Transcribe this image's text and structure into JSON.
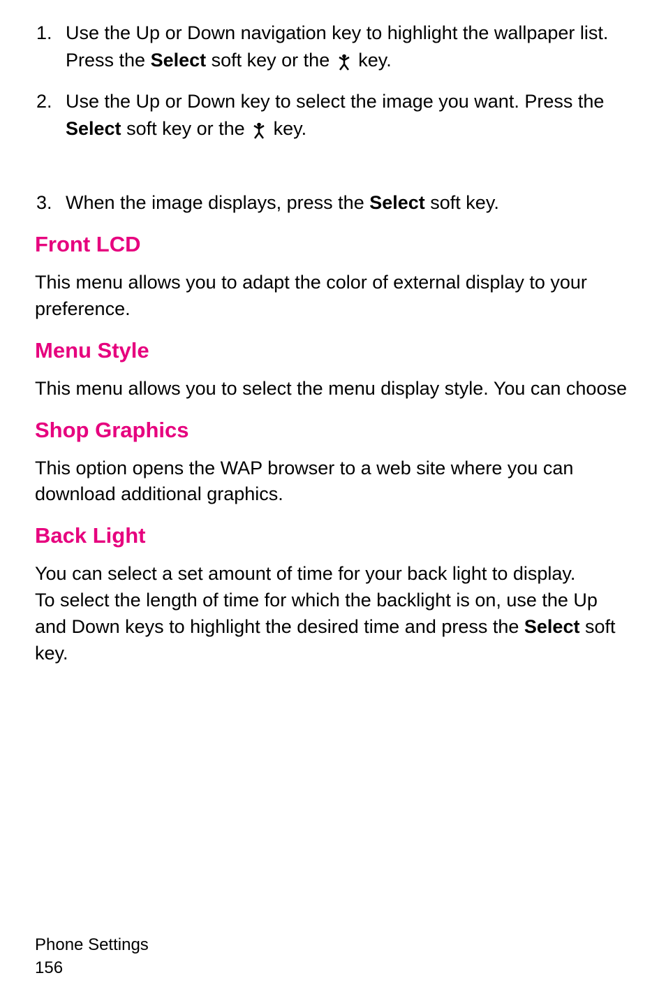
{
  "steps": [
    {
      "num": "1.",
      "pre": "Use the Up or Down navigation key to highlight the wallpaper list. Press the ",
      "bold": "Select",
      "mid": " soft key or the ",
      "post": " key."
    },
    {
      "num": "2.",
      "pre": "Use the Up or Down key to select the image you want.  Press the ",
      "bold": "Select",
      "mid": " soft key or the ",
      "post": " key."
    },
    {
      "num": "3.",
      "pre": "When the image displays, press the ",
      "bold": "Select",
      "post": " soft key."
    }
  ],
  "sections": {
    "frontlcd": {
      "heading": "Front LCD",
      "text": "This menu allows you to adapt the color of external display to your preference."
    },
    "menustyle": {
      "heading": "Menu Style",
      "text": "This menu allows you to select the menu display style. You can choose"
    },
    "shopgraphics": {
      "heading": "Shop Graphics",
      "text": "This option opens the WAP browser to a web site where you can download additional graphics."
    },
    "backlight": {
      "heading": "Back Light",
      "p1": "You can select a set amount of time for your back light to display.",
      "p2_pre": "To select the length of time for which the backlight is on, use the Up and Down keys to highlight the desired time and press the ",
      "p2_bold": "Select",
      "p2_post": " soft key."
    }
  },
  "footer": {
    "title": "Phone Settings",
    "page": " 156"
  }
}
